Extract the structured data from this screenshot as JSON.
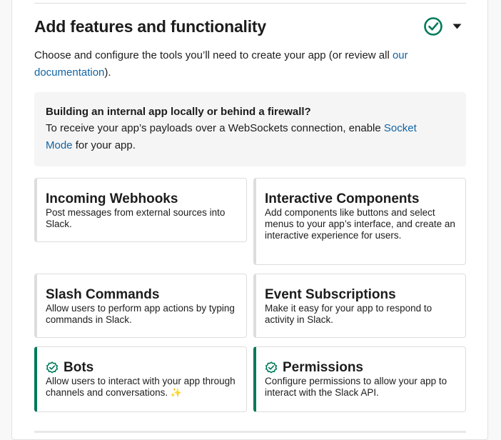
{
  "section": {
    "title": "Add features and functionality",
    "intro_text": "Choose and configure the tools you’ll need to create your app (or review all ",
    "intro_link": "our documentation",
    "intro_suffix": ")."
  },
  "callout": {
    "title": "Building an internal app locally or behind a firewall?",
    "body_text": "To receive your app’s payloads over a WebSockets connection, enable ",
    "body_link": "Socket Mode",
    "body_suffix": " for your app."
  },
  "features": [
    {
      "title": "Incoming Webhooks",
      "description": "Post messages from external sources into Slack.",
      "enabled": false
    },
    {
      "title": "Interactive Components",
      "description": "Add components like buttons and select menus to your app’s interface, and create an interactive experience for users.",
      "enabled": false
    },
    {
      "title": "Slash Commands",
      "description": "Allow users to perform app actions by typing commands in Slack.",
      "enabled": false
    },
    {
      "title": "Event Subscriptions",
      "description": "Make it easy for your app to respond to activity in Slack.",
      "enabled": false
    },
    {
      "title": "Bots",
      "description": "Allow users to interact with your app through channels and conversations.",
      "sparkle": "✨",
      "enabled": true
    },
    {
      "title": "Permissions",
      "description": "Configure permissions to allow your app to interact with the Slack API.",
      "enabled": true
    }
  ],
  "icons": {
    "section_status": "check-circle-icon",
    "toggle": "caret-down-icon",
    "feature_enabled": "badge-check-icon"
  },
  "colors": {
    "accent_green": "#007a5a",
    "link_blue": "#1264a3",
    "text": "#1d1c1d"
  }
}
